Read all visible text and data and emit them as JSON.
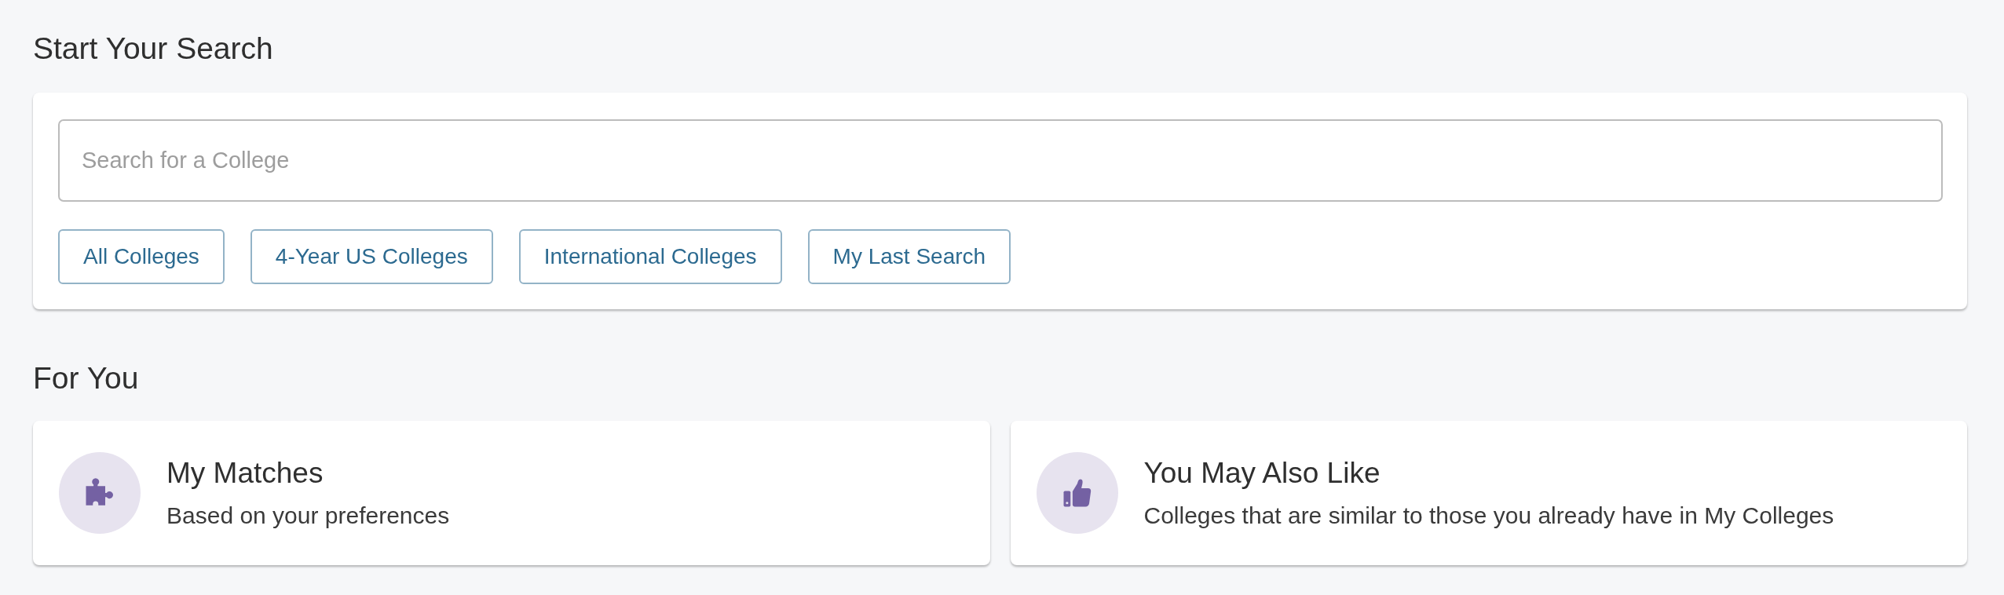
{
  "search_section": {
    "heading": "Start Your Search",
    "search": {
      "placeholder": "Search for a College"
    },
    "filters": [
      "All Colleges",
      "4-Year US Colleges",
      "International Colleges",
      "My Last Search"
    ]
  },
  "for_you": {
    "heading": "For You",
    "cards": [
      {
        "kind": "matches",
        "title": "My Matches",
        "subtitle": "Based on your preferences"
      },
      {
        "kind": "suggestions",
        "title": "You May Also Like",
        "subtitle": "Colleges that are similar to those you already have in My Colleges"
      }
    ]
  }
}
